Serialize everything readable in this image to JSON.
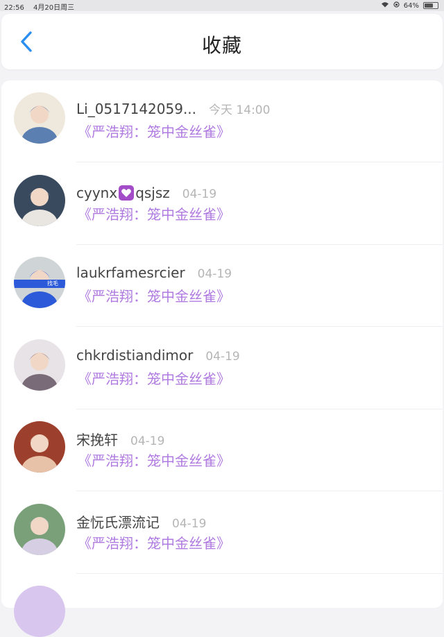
{
  "status": {
    "time": "22:56",
    "date": "4月20日周三",
    "battery": "64%",
    "battery_level": 0.64
  },
  "nav": {
    "title": "收藏",
    "back_icon": "chevron-left-icon",
    "accent": "#2a8ef0"
  },
  "colors": {
    "subtitle": "#b07be0",
    "time": "#b5b5b5"
  },
  "items": [
    {
      "name": "Li_0517142059...",
      "time": "今天 14:00",
      "title": "《严浩翔：笼中金丝雀》",
      "avatar_colors": [
        "#efe9dd",
        "#5b7fb0"
      ]
    },
    {
      "name_pre": "cyynx",
      "name_post": "qsjsz",
      "has_emoji": true,
      "emoji": "purple-heart-icon",
      "time": "04-19",
      "title": "《严浩翔：笼中金丝雀》",
      "avatar_colors": [
        "#3a4a5e",
        "#e9e6e2"
      ]
    },
    {
      "name": "laukrfamesrcier",
      "time": "04-19",
      "title": "《严浩翔：笼中金丝雀》",
      "avatar_colors": [
        "#cfd4d6",
        "#2c5ad8"
      ],
      "avatar_text": "找毛"
    },
    {
      "name": "chkrdistiandimor",
      "time": "04-19",
      "title": "《严浩翔：笼中金丝雀》",
      "avatar_colors": [
        "#e7e3e6",
        "#7a6b78"
      ]
    },
    {
      "name": "宋挽轩",
      "time": "04-19",
      "title": "《严浩翔：笼中金丝雀》",
      "avatar_colors": [
        "#9c3f2c",
        "#e8c2a8"
      ]
    },
    {
      "name": "金忨氏漂流记",
      "time": "04-19",
      "title": "《严浩翔：笼中金丝雀》",
      "avatar_colors": [
        "#7aa07a",
        "#d6cfe4"
      ]
    }
  ]
}
